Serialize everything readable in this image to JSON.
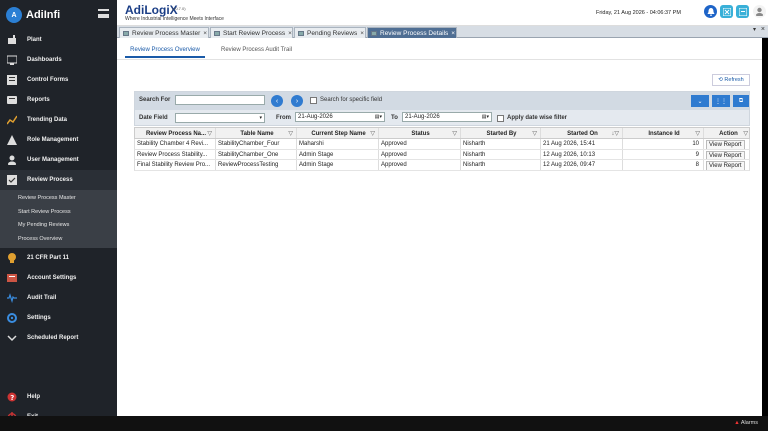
{
  "brand": {
    "name": "AdiInfi"
  },
  "sidebar": {
    "items": [
      {
        "label": "Plant"
      },
      {
        "label": "Dashboards"
      },
      {
        "label": "Control Forms"
      },
      {
        "label": "Reports"
      },
      {
        "label": "Trending Data"
      },
      {
        "label": "Role Management"
      },
      {
        "label": "User Management"
      },
      {
        "label": "Review Process"
      }
    ],
    "sub_items": [
      {
        "label": "Review Process Master"
      },
      {
        "label": "Start Review Process"
      },
      {
        "label": "My Pending Reviews"
      },
      {
        "label": "Process Overview"
      }
    ],
    "items_after": [
      {
        "label": "21 CFR Part 11"
      },
      {
        "label": "Account Settings"
      },
      {
        "label": "Audit Trail"
      },
      {
        "label": "Settings"
      },
      {
        "label": "Scheduled Report"
      }
    ],
    "bottom": [
      {
        "label": "Help"
      },
      {
        "label": "Exit"
      }
    ]
  },
  "header": {
    "app_name": "AdiLogi",
    "app_name_x": "X",
    "version": "(v0.7.0)",
    "tagline": "Where Industrial Intelligence Meets Interface",
    "datetime": "Friday, 21 Aug 2026 - 04:06:37 PM"
  },
  "tabs": [
    {
      "label": "Review Process Master"
    },
    {
      "label": "Start Review Process"
    },
    {
      "label": "Pending Reviews"
    },
    {
      "label": "Review Process Details"
    }
  ],
  "page": {
    "sub_tabs": [
      {
        "label": "Review Process Overview"
      },
      {
        "label": "Review Process Audit Trail"
      }
    ],
    "refresh_label": "⟲ Refresh"
  },
  "filter": {
    "search_label": "Search For",
    "search_value": "",
    "specific_field_label": "Search for specific field",
    "date_field_label": "Date Field",
    "date_field_value": "",
    "from_label": "From",
    "from_value": "21-Aug-2026",
    "to_label": "To",
    "to_value": "21-Aug-2026",
    "apply_date_label": "Apply date wise filter"
  },
  "grid": {
    "columns": [
      "Review Process Na...",
      "Table Name",
      "Current Step Name",
      "Status",
      "Started By",
      "Started On",
      "Instance Id",
      "Action"
    ],
    "rows": [
      {
        "name": "Stability Chamber 4 Revi...",
        "table": "StabilityChamber_Four",
        "step": "Maharshi",
        "status": "Approved",
        "by": "Nisharth",
        "on": "21 Aug 2026, 15:41",
        "id": "10",
        "action": "View Report"
      },
      {
        "name": "Review Process Stability...",
        "table": "StabilityChamber_One",
        "step": "Admin Stage",
        "status": "Approved",
        "by": "Nisharth",
        "on": "12 Aug 2026, 10:13",
        "id": "9",
        "action": "View Report"
      },
      {
        "name": "Final Stability Review Pro...",
        "table": "ReviewProcessTesting",
        "step": "Admin Stage",
        "status": "Approved",
        "by": "Nisharth",
        "on": "12 Aug 2026, 09:47",
        "id": "8",
        "action": "View Report"
      }
    ]
  },
  "footer": {
    "alarms_label": "Alarms"
  },
  "colors": {
    "accent": "#2f7bd0",
    "sidebar": "#1f2329",
    "active_tab": "#4f6e93"
  }
}
